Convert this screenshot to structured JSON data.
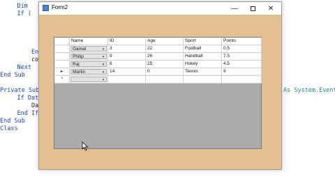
{
  "code_lines": [
    {
      "text": "    Dim "
    },
    {
      "text": "    If ("
    },
    {
      "text": "        End"
    },
    {
      "text": "        conn"
    },
    {
      "text": "    Next"
    },
    {
      "text": "End Sub"
    },
    {
      "text": "Private Sub"
    },
    {
      "text": "    If DataG"
    },
    {
      "text": "        Data"
    },
    {
      "text": "    End If"
    },
    {
      "text": "End Sub"
    },
    {
      "text": "Class"
    },
    {
      "text": "As System.EventA"
    }
  ],
  "window": {
    "title": "Form2",
    "minimize_glyph": "—",
    "close_glyph": "✕"
  },
  "grid": {
    "columns": [
      "Name",
      "ID",
      "Age",
      "Sport",
      "Points"
    ],
    "rows": [
      {
        "name": "Gamal",
        "id": "3",
        "age": "22",
        "sport": "Football",
        "points": "0.5",
        "marker": ""
      },
      {
        "name": "Philip",
        "id": "9",
        "age": "26",
        "sport": "Handball",
        "points": "7.5",
        "marker": ""
      },
      {
        "name": "Raj",
        "id": "6",
        "age": "25",
        "sport": "Hokey",
        "points": "4.5",
        "marker": ""
      },
      {
        "name": "Martin",
        "id": "14",
        "age": "0",
        "sport": "Tennis",
        "points": "9",
        "marker": "▸"
      },
      {
        "name": "",
        "id": "",
        "age": "",
        "sport": "",
        "points": "",
        "marker": "*"
      }
    ],
    "combo_arrow": "▾"
  }
}
